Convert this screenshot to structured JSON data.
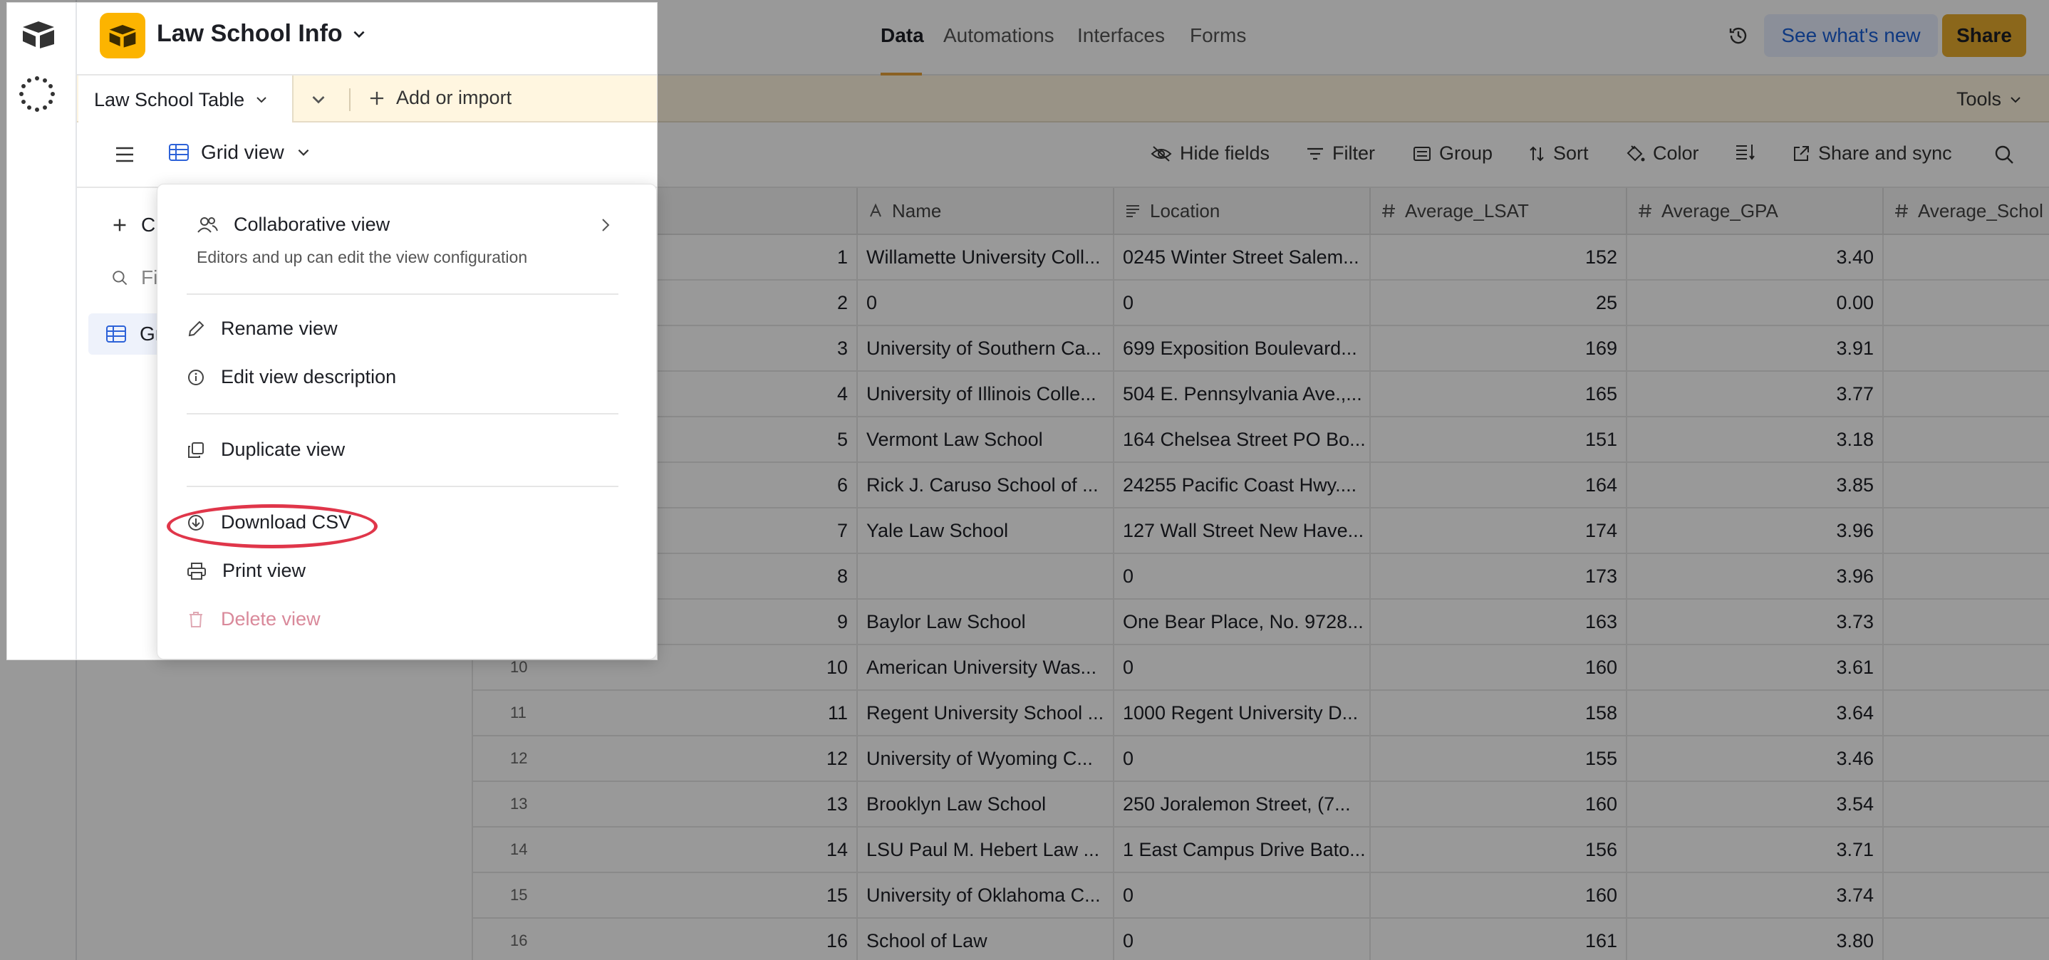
{
  "base": {
    "title": "Law School Info"
  },
  "nav": {
    "tabs": [
      "Data",
      "Automations",
      "Interfaces",
      "Forms"
    ],
    "active": "Data"
  },
  "header": {
    "whats_new": "See what's new",
    "share": "Share"
  },
  "tablebar": {
    "table_name": "Law School Table",
    "add_import": "Add or import",
    "tools": "Tools"
  },
  "viewbar": {
    "view_name": "Grid view",
    "tools": [
      "Hide fields",
      "Filter",
      "Group",
      "Sort",
      "Color",
      "Share and sync"
    ]
  },
  "sidebar": {
    "create_partial": "C",
    "find_partial": "Fi",
    "grid_partial": "Gr"
  },
  "columns": [
    "Name",
    "Location",
    "Average_LSAT",
    "Average_GPA",
    "Average_Schol"
  ],
  "rows": [
    {
      "n": "1",
      "name": "Willamette University Coll...",
      "loc": "0245 Winter Street Salem...",
      "lsat": "152",
      "gpa": "3.40"
    },
    {
      "n": "2",
      "name": "0",
      "loc": "0",
      "lsat": "25",
      "gpa": "0.00"
    },
    {
      "n": "3",
      "name": "University of Southern Ca...",
      "loc": "699 Exposition Boulevard...",
      "lsat": "169",
      "gpa": "3.91"
    },
    {
      "n": "4",
      "name": "University of Illinois Colle...",
      "loc": "504 E. Pennsylvania Ave.,...",
      "lsat": "165",
      "gpa": "3.77"
    },
    {
      "n": "5",
      "name": "Vermont Law School",
      "loc": "164 Chelsea Street PO Bo...",
      "lsat": "151",
      "gpa": "3.18"
    },
    {
      "n": "6",
      "name": "Rick J. Caruso School of ...",
      "loc": "24255 Pacific Coast Hwy....",
      "lsat": "164",
      "gpa": "3.85"
    },
    {
      "n": "7",
      "name": "Yale Law School",
      "loc": "127 Wall Street New Have...",
      "lsat": "174",
      "gpa": "3.96"
    },
    {
      "n": "8",
      "name": "",
      "loc": "0",
      "lsat": "173",
      "gpa": "3.96"
    },
    {
      "n": "9",
      "name": "Baylor Law School",
      "loc": "One Bear Place, No. 9728...",
      "lsat": "163",
      "gpa": "3.73"
    },
    {
      "n": "10",
      "name": "American University Was...",
      "loc": "0",
      "lsat": "160",
      "gpa": "3.61"
    },
    {
      "n": "11",
      "name": "Regent University School ...",
      "loc": "1000 Regent University D...",
      "lsat": "158",
      "gpa": "3.64"
    },
    {
      "n": "12",
      "name": "University of Wyoming C...",
      "loc": "0",
      "lsat": "155",
      "gpa": "3.46"
    },
    {
      "n": "13",
      "name": "Brooklyn Law School",
      "loc": "250 Joralemon Street, (7...",
      "lsat": "160",
      "gpa": "3.54"
    },
    {
      "n": "14",
      "name": "LSU Paul M. Hebert Law ...",
      "loc": "1 East Campus Drive Bato...",
      "lsat": "156",
      "gpa": "3.71"
    },
    {
      "n": "15",
      "name": "University of Oklahoma C...",
      "loc": "0",
      "lsat": "160",
      "gpa": "3.74"
    },
    {
      "n": "16",
      "name": "School of Law",
      "loc": "0",
      "lsat": "161",
      "gpa": "3.80"
    }
  ],
  "menu": {
    "collaborative": "Collaborative view",
    "collaborative_desc": "Editors and up can edit the view configuration",
    "rename": "Rename view",
    "edit_desc": "Edit view description",
    "duplicate": "Duplicate view",
    "download_csv": "Download CSV",
    "print": "Print view",
    "delete": "Delete view"
  }
}
